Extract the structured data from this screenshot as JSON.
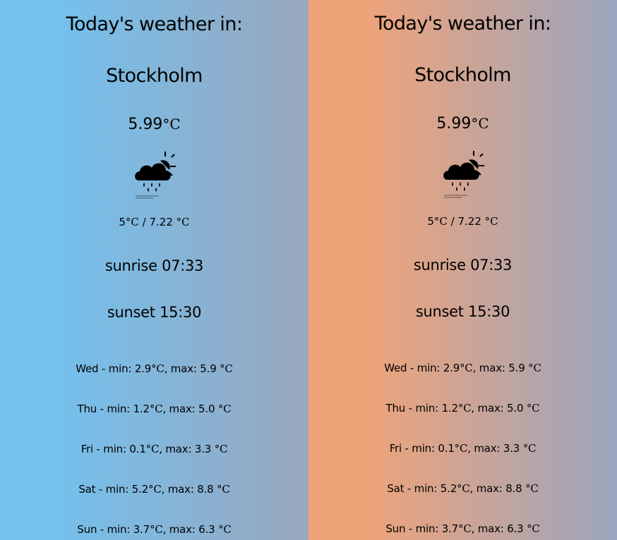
{
  "panels": [
    {
      "title": "Today's weather in:",
      "city": "Stockholm",
      "temp_value": "5.99",
      "unit": "°C",
      "icon": "cloud-rain-sun-icon",
      "min_value": "5",
      "max_value": "7.22",
      "sunrise": "sunrise 07:33",
      "sunset": "sunset 15:30",
      "forecast": [
        {
          "prefix": "Wed - min: 2.9",
          "mid": ", max: 5.9 "
        },
        {
          "prefix": "Thu - min: 1.2",
          "mid": ", max: 5.0 "
        },
        {
          "prefix": "Fri - min: 0.1",
          "mid": ", max: 3.3 "
        },
        {
          "prefix": "Sat - min: 5.2",
          "mid": ", max: 8.8 "
        },
        {
          "prefix": "Sun - min: 3.7",
          "mid": ", max: 6.3 "
        }
      ]
    },
    {
      "title": "Today's weather in:",
      "city": "Stockholm",
      "temp_value": "5.99",
      "unit": "°C",
      "icon": "cloud-rain-sun-icon",
      "min_value": "5",
      "max_value": "7.22",
      "sunrise": "sunrise 07:33",
      "sunset": "sunset 15:30",
      "forecast": [
        {
          "prefix": "Wed - min: 2.9",
          "mid": ", max: 5.9 "
        },
        {
          "prefix": "Thu - min: 1.2",
          "mid": ", max: 5.0 "
        },
        {
          "prefix": "Fri - min: 0.1",
          "mid": ", max: 3.3 "
        },
        {
          "prefix": "Sat - min: 5.2",
          "mid": ", max: 8.8 "
        },
        {
          "prefix": "Sun - min: 3.7",
          "mid": ", max: 6.3 "
        }
      ]
    }
  ],
  "colors": {
    "left_start": "#73c1ef",
    "right_start": "#efa379",
    "gradient_end": "#9ba6bf"
  }
}
